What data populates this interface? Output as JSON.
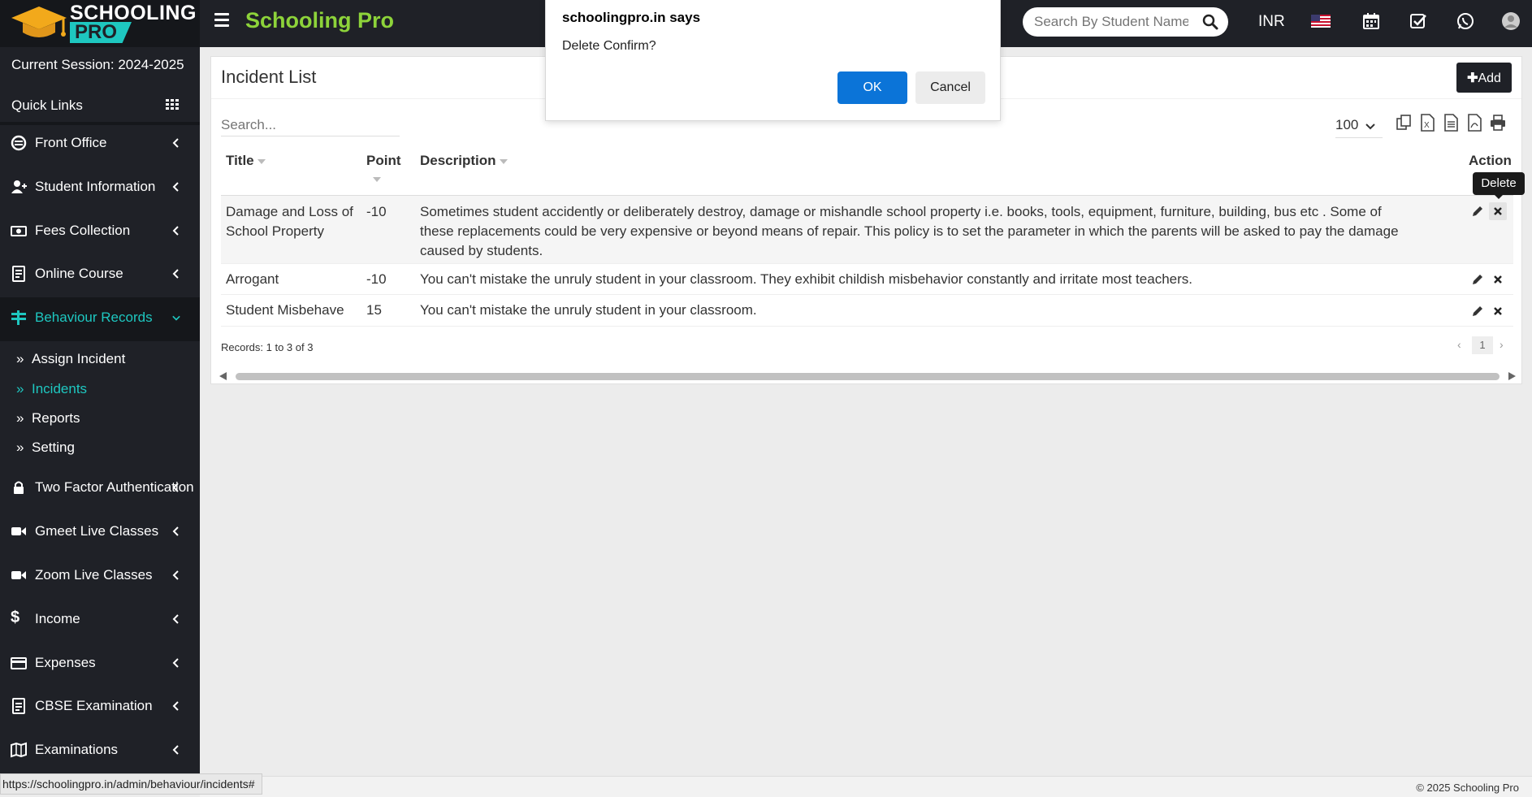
{
  "topbar": {
    "logo_line1": "SCHOOLING",
    "logo_line2": "PRO",
    "brand": "Schooling Pro",
    "search_placeholder": "Search By Student Name",
    "currency": "INR",
    "icons": [
      "calendar-icon",
      "tasks-check-icon",
      "whatsapp-icon",
      "user-avatar-icon"
    ]
  },
  "sidebar": {
    "session": "Current Session: 2024-2025",
    "quick_links": "Quick Links",
    "items": [
      {
        "label": "Front Office",
        "icon": "front-office-icon"
      },
      {
        "label": "Student Information",
        "icon": "user-plus-icon"
      },
      {
        "label": "Fees Collection",
        "icon": "money-icon"
      },
      {
        "label": "Online Course",
        "icon": "course-icon"
      },
      {
        "label": "Behaviour Records",
        "icon": "behaviour-icon"
      },
      {
        "label": "Two Factor Authentication",
        "icon": "lock-icon"
      },
      {
        "label": "Gmeet Live Classes",
        "icon": "video-icon"
      },
      {
        "label": "Zoom Live Classes",
        "icon": "video-icon"
      },
      {
        "label": "Income",
        "icon": "dollar-icon"
      },
      {
        "label": "Expenses",
        "icon": "credit-card-icon"
      },
      {
        "label": "CBSE Examination",
        "icon": "document-icon"
      },
      {
        "label": "Examinations",
        "icon": "map-icon"
      }
    ],
    "subitems": [
      {
        "label": "Assign Incident"
      },
      {
        "label": "Incidents"
      },
      {
        "label": "Reports"
      },
      {
        "label": "Setting"
      }
    ],
    "active_color": "#1ec7c0"
  },
  "main": {
    "title": "Incident List",
    "add_label": "Add",
    "search_placeholder": "Search...",
    "page_size": "100",
    "columns": {
      "title": "Title",
      "point": "Point",
      "description": "Description",
      "action": "Action"
    },
    "rows": [
      {
        "title": "Damage and Loss of School Property",
        "point": "-10",
        "description": "Sometimes student accidently or deliberately destroy, damage or mishandle school property i.e. books, tools, equipment, furniture, building, bus etc . Some of these replacements could be very expensive or beyond means of repair. This policy is to set the parameter in which the parents will be asked to pay the damage caused by students."
      },
      {
        "title": "Arrogant",
        "point": "-10",
        "description": "You can't mistake the unruly student in your classroom. They exhibit childish misbehavior constantly and irritate most teachers."
      },
      {
        "title": "Student Misbehave",
        "point": "15",
        "description": "You can't mistake the unruly student in your classroom."
      }
    ],
    "records": "Records: 1 to 3 of 3",
    "current_page": "1",
    "tooltip": "Delete"
  },
  "dialog": {
    "title": "schoolingpro.in says",
    "message": "Delete Confirm?",
    "ok": "OK",
    "cancel": "Cancel"
  },
  "footer": {
    "copyright": "© 2025 Schooling Pro",
    "status_url": "https://schoolingpro.in/admin/behaviour/incidents#"
  }
}
